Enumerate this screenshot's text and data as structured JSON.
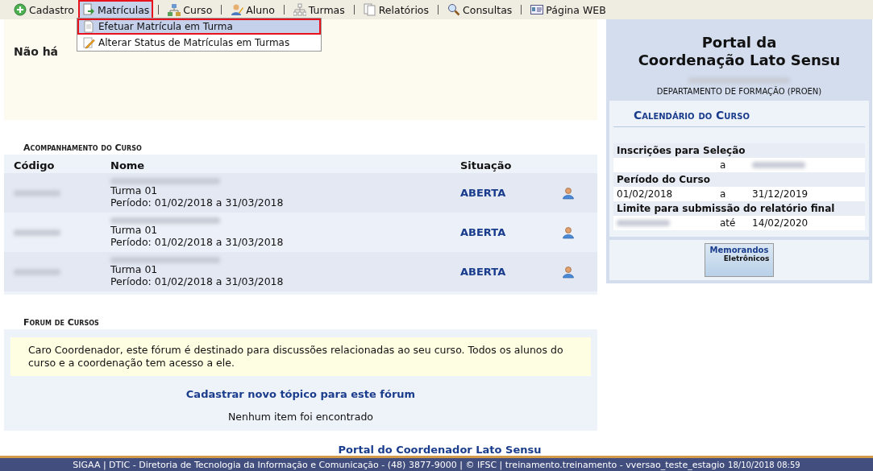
{
  "menu_bar": {
    "items": [
      {
        "label": "Cadastro",
        "kind": "plus",
        "selected": false,
        "highlighted": false
      },
      {
        "label": "Matrículas",
        "kind": "doc-arrow",
        "selected": true,
        "highlighted": true
      },
      {
        "label": "Curso",
        "kind": "network",
        "selected": false,
        "highlighted": false
      },
      {
        "label": "Aluno",
        "kind": "person-pencil",
        "selected": false,
        "highlighted": false
      },
      {
        "label": "Turmas",
        "kind": "hierarchy",
        "selected": false,
        "highlighted": false
      },
      {
        "label": "Relatórios",
        "kind": "docs",
        "selected": false,
        "highlighted": false
      },
      {
        "label": "Consultas",
        "kind": "search",
        "selected": false,
        "highlighted": false
      },
      {
        "label": "Página WEB",
        "kind": "card",
        "selected": false,
        "highlighted": false
      }
    ]
  },
  "dropdown": {
    "items": [
      {
        "label": "Efetuar Matrícula em Turma",
        "kind": "doc",
        "selected": true,
        "highlighted": true
      },
      {
        "label": "Alterar Status de Matrículas em Turmas",
        "kind": "pencil",
        "selected": false,
        "highlighted": false
      }
    ]
  },
  "news": {
    "message": "Não há"
  },
  "course_tracking": {
    "title": "Acompanhamento do Curso",
    "columns": [
      "Código",
      "Nome",
      "Situação"
    ],
    "rows": [
      {
        "class": "Turma 01",
        "period": "Período: 01/02/2018 a 31/03/2018",
        "status": "ABERTA"
      },
      {
        "class": "Turma 01",
        "period": "Período: 01/02/2018 a 31/03/2018",
        "status": "ABERTA"
      },
      {
        "class": "Turma 01",
        "period": "Período: 01/02/2018 a 31/03/2018",
        "status": "ABERTA"
      }
    ]
  },
  "forum": {
    "title": "Forum de Cursos",
    "notice": "Caro Coordenador, este fórum é destinado para discussões relacionadas ao seu curso. Todos os alunos do curso e a coordenação tem acesso a ele.",
    "new_topic_link": "Cadastrar novo tópico para este fórum",
    "empty_message": "Nenhum item foi encontrado"
  },
  "portal_link": "Portal do Coordenador Lato Sensu",
  "side_panel": {
    "title_line_1": "Portal da",
    "title_line_2": "Coordenação Lato Sensu",
    "department": "DEPARTAMENTO DE FORMAÇÃO (PROEN)",
    "calendar": {
      "title": "Calendário do Curso",
      "entries": [
        {
          "label": "Inscrições para Seleção",
          "separator": "a"
        },
        {
          "label": "Período do Curso",
          "start": "01/02/2018",
          "separator": "a",
          "end": "31/12/2019"
        },
        {
          "label": "Limite para submissão do relatório final",
          "separator": "até",
          "end": "14/02/2020"
        }
      ]
    },
    "memo_button": {
      "line_1": "Memorandos",
      "line_2": "Eletrônicos"
    }
  },
  "footer": {
    "text": "SIGAA | DTIC - Diretoria de Tecnologia da Informação e Comunicação - (48) 3877-9000 | © IFSC | treinamento.treinamento - vversao_teste_estagio",
    "timestamp": "18/10/2018 08:59"
  }
}
